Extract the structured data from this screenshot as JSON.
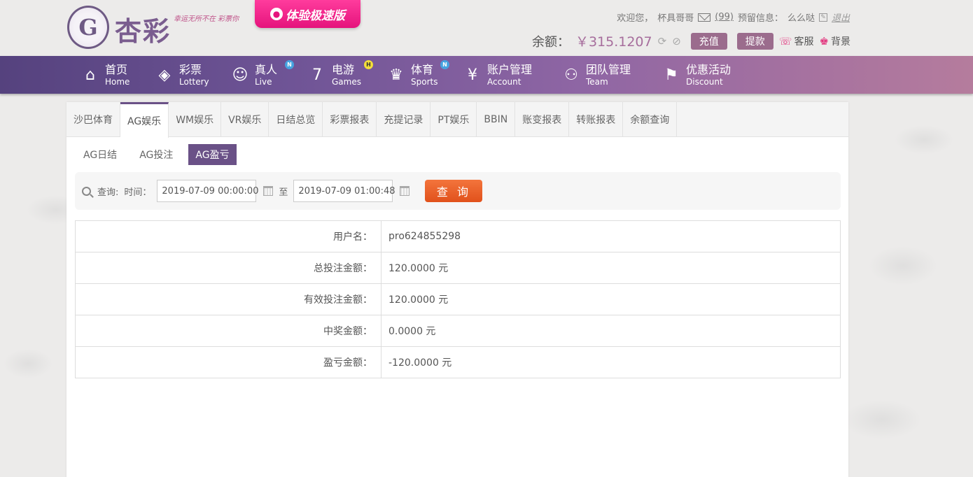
{
  "header": {
    "logo_text": "杏彩",
    "slogan": "幸运无所不在 彩票你",
    "promo_label": "体验极速版",
    "welcome": "欢迎您，",
    "username": "杯具哥哥",
    "mail_count": "(99)",
    "reserved_label": "预留信息：",
    "reserved_value": "么么哒",
    "logout": "退出",
    "balance_label": "余额：",
    "balance_value": "￥315.1207",
    "deposit": "充值",
    "withdraw": "提款",
    "service": "客服",
    "background": "背景"
  },
  "nav": [
    {
      "cn": "首页",
      "en": "Home",
      "icon": "home-icon",
      "badge": ""
    },
    {
      "cn": "彩票",
      "en": "Lottery",
      "icon": "lottery-icon",
      "badge": ""
    },
    {
      "cn": "真人",
      "en": "Live",
      "icon": "live-icon",
      "badge": "N"
    },
    {
      "cn": "电游",
      "en": "Games",
      "icon": "games-icon",
      "badge": "H"
    },
    {
      "cn": "体育",
      "en": "Sports",
      "icon": "trophy-icon",
      "badge": "N"
    },
    {
      "cn": "账户管理",
      "en": "Account",
      "icon": "account-icon",
      "badge": ""
    },
    {
      "cn": "团队管理",
      "en": "Team",
      "icon": "team-icon",
      "badge": ""
    },
    {
      "cn": "优惠活动",
      "en": "Discount",
      "icon": "gift-icon",
      "badge": ""
    }
  ],
  "tabs": [
    "沙巴体育",
    "AG娱乐",
    "WM娱乐",
    "VR娱乐",
    "日结总览",
    "彩票报表",
    "充提记录",
    "PT娱乐",
    "BBIN",
    "账变报表",
    "转账报表",
    "余额查询"
  ],
  "active_tab": "AG娱乐",
  "subtabs": [
    "AG日结",
    "AG投注",
    "AG盈亏"
  ],
  "active_subtab": "AG盈亏",
  "query": {
    "label": "查询:",
    "time_label": "时间：",
    "start": "2019-07-09 00:00:00",
    "to": "至",
    "end": "2019-07-09 01:00:48",
    "button": "查 询"
  },
  "results": [
    {
      "label": "用户名：",
      "value": "pro624855298"
    },
    {
      "label": "总投注金额：",
      "value": "120.0000 元"
    },
    {
      "label": "有效投注金额：",
      "value": "120.0000 元"
    },
    {
      "label": "中奖金额：",
      "value": "0.0000 元"
    },
    {
      "label": "盈亏金额：",
      "value": "-120.0000 元"
    }
  ]
}
